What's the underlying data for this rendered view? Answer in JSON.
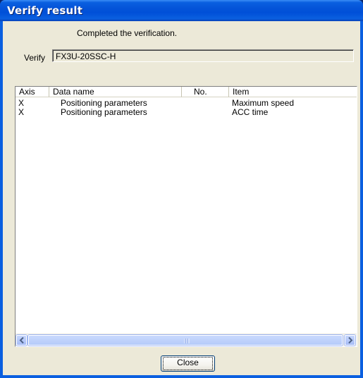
{
  "window": {
    "title": "Verify result"
  },
  "message": "Completed the verification.",
  "verify": {
    "label": "Verify",
    "value": "FX3U-20SSC-H"
  },
  "list": {
    "columns": [
      "Axis",
      "Data name",
      "No.",
      "Item"
    ],
    "rows": [
      {
        "axis": "X",
        "data_name": "Positioning parameters",
        "no": "",
        "item": "Maximum speed"
      },
      {
        "axis": "X",
        "data_name": "Positioning parameters",
        "no": "",
        "item": "ACC time"
      }
    ]
  },
  "buttons": {
    "close": "Close"
  },
  "icons": {
    "scroll_left": "arrow-left-icon",
    "scroll_right": "arrow-right-icon",
    "grip": "scroll-grip-icon"
  },
  "colors": {
    "titlebar": "#0453d8",
    "client": "#ece9d8"
  }
}
